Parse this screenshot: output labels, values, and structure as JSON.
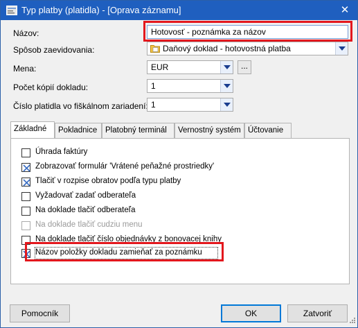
{
  "window": {
    "title": "Typ platby (platidla) - [Oprava záznamu]",
    "close_glyph": "✕"
  },
  "form": {
    "nazov": {
      "label": "Názov:",
      "value": "Hotovosť - poznámka za názov"
    },
    "sposob": {
      "label": "Spôsob zaevidovania:",
      "value": "Daňový doklad - hotovostná platba",
      "icon": "folder-document-icon"
    },
    "mena": {
      "label": "Mena:",
      "value": "EUR",
      "button_label": "..."
    },
    "pocet_kopii": {
      "label": "Počet kópií dokladu:",
      "value": "1"
    },
    "cislo_platidla": {
      "label": "Číslo platidla vo fiškálnom zariadení:",
      "value": "1"
    }
  },
  "tabs": [
    {
      "label": "Základné",
      "active": true
    },
    {
      "label": "Pokladnice",
      "active": false
    },
    {
      "label": "Platobný terminál",
      "active": false
    },
    {
      "label": "Vernostný systém",
      "active": false
    },
    {
      "label": "Účtovanie",
      "active": false
    }
  ],
  "checkboxes": [
    {
      "label": "Úhrada faktúry",
      "checked": false,
      "enabled": true
    },
    {
      "label": "Zobrazovať formulár 'Vrátené peňažné prostriedky'",
      "checked": true,
      "enabled": true
    },
    {
      "label": "Tlačiť v rozpise obratov podľa typu platby",
      "checked": true,
      "enabled": true
    },
    {
      "label": "Vyžadovať zadať odberateľa",
      "checked": false,
      "enabled": true
    },
    {
      "label": "Na doklade tlačiť odberateľa",
      "checked": false,
      "enabled": true
    },
    {
      "label": "Na doklade tlačiť cudziu menu",
      "checked": false,
      "enabled": false
    },
    {
      "label": "Na doklade tlačiť číslo objednávky z bonovacej knihy",
      "checked": false,
      "enabled": true
    },
    {
      "label": "Názov položky dokladu zamieňať za poznámku",
      "checked": true,
      "enabled": true
    }
  ],
  "buttons": {
    "help": "Pomocník",
    "ok": "OK",
    "close": "Zatvoriť"
  },
  "colors": {
    "titlebar": "#1f5fbf",
    "highlight": "#e3171d",
    "check": "#3b6fc4"
  }
}
